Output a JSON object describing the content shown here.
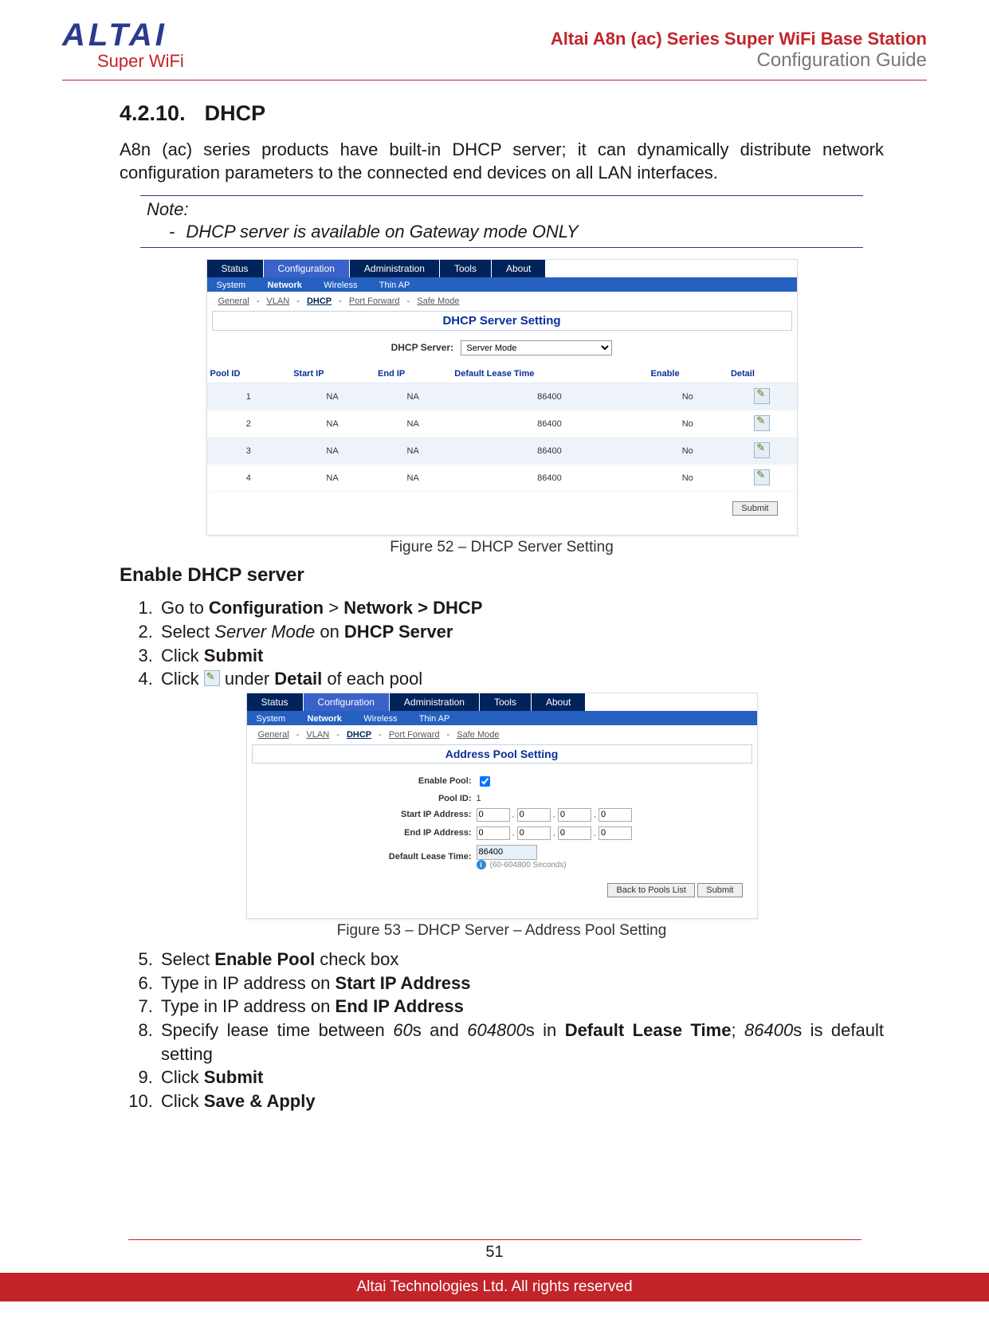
{
  "header": {
    "brand_top": "ALTAI",
    "brand_sub": "Super WiFi",
    "right_line1": "Altai A8n (ac) Series Super WiFi Base Station",
    "right_line2": "Configuration Guide"
  },
  "section": {
    "number": "4.2.10.",
    "title": "DHCP"
  },
  "intro": "A8n (ac) series products have built-in DHCP server; it can dynamically distribute network configuration parameters to the connected end devices on all LAN interfaces.",
  "note": {
    "title": "Note:",
    "item": "DHCP server is available on Gateway mode ONLY"
  },
  "fig1": {
    "caption": "Figure 52 – DHCP Server Setting",
    "tabs1": [
      "Status",
      "Configuration",
      "Administration",
      "Tools",
      "About"
    ],
    "tabs1_active": 1,
    "tabs2": [
      "System",
      "Network",
      "Wireless",
      "Thin AP"
    ],
    "tabs2_active": 1,
    "tabs3": [
      "General",
      "VLAN",
      "DHCP",
      "Port Forward",
      "Safe Mode"
    ],
    "tabs3_active": 2,
    "banner": "DHCP Server Setting",
    "form_label": "DHCP Server:",
    "form_value": "Server Mode",
    "columns": [
      "Pool ID",
      "Start IP",
      "End IP",
      "Default Lease Time",
      "Enable",
      "Detail"
    ],
    "rows": [
      {
        "id": "1",
        "start": "NA",
        "end": "NA",
        "lease": "86400",
        "enable": "No"
      },
      {
        "id": "2",
        "start": "NA",
        "end": "NA",
        "lease": "86400",
        "enable": "No"
      },
      {
        "id": "3",
        "start": "NA",
        "end": "NA",
        "lease": "86400",
        "enable": "No"
      },
      {
        "id": "4",
        "start": "NA",
        "end": "NA",
        "lease": "86400",
        "enable": "No"
      }
    ],
    "submit": "Submit"
  },
  "subheading": "Enable DHCP server",
  "steps_a": {
    "s1_pre": "Go to ",
    "s1_b": "Configuration",
    "s1_gt": " > ",
    "s1_b2": "Network > DHCP",
    "s2_pre": "Select ",
    "s2_i": "Server Mode",
    "s2_mid": " on ",
    "s2_b": "DHCP Server",
    "s3_pre": "Click ",
    "s3_b": "Submit",
    "s4_pre": "Click ",
    "s4_mid": " under ",
    "s4_b": "Detail",
    "s4_post": " of each pool"
  },
  "fig2": {
    "caption": "Figure 53 – DHCP Server – Address Pool Setting",
    "banner": "Address Pool Setting",
    "labels": {
      "enable": "Enable Pool:",
      "poolid": "Pool ID:",
      "start": "Start IP Address:",
      "end": "End IP Address:",
      "lease": "Default Lease Time:"
    },
    "poolid_val": "1",
    "ip_default": "0",
    "lease_val": "86400",
    "hint": "(60-604800 Seconds)",
    "btn_back": "Back to Pools List",
    "btn_submit": "Submit"
  },
  "steps_b": {
    "s5_pre": "Select ",
    "s5_b": "Enable Pool",
    "s5_post": " check box",
    "s6_pre": "Type in IP address on ",
    "s6_b": "Start IP Address",
    "s7_pre": "Type in IP address on ",
    "s7_b": "End IP Address",
    "s8_pre": "Specify lease time between ",
    "s8_i1": "60",
    "s8_mid1": "s and ",
    "s8_i2": "604800",
    "s8_mid2": "s in ",
    "s8_b": "Default Lease Time",
    "s8_mid3": "; ",
    "s8_i3": "86400",
    "s8_post": "s is default setting",
    "s9_pre": "Click ",
    "s9_b": "Submit",
    "s10_pre": "Click ",
    "s10_b": "Save & Apply"
  },
  "footer": {
    "page": "51",
    "copyright": "Altai Technologies Ltd. All rights reserved"
  }
}
